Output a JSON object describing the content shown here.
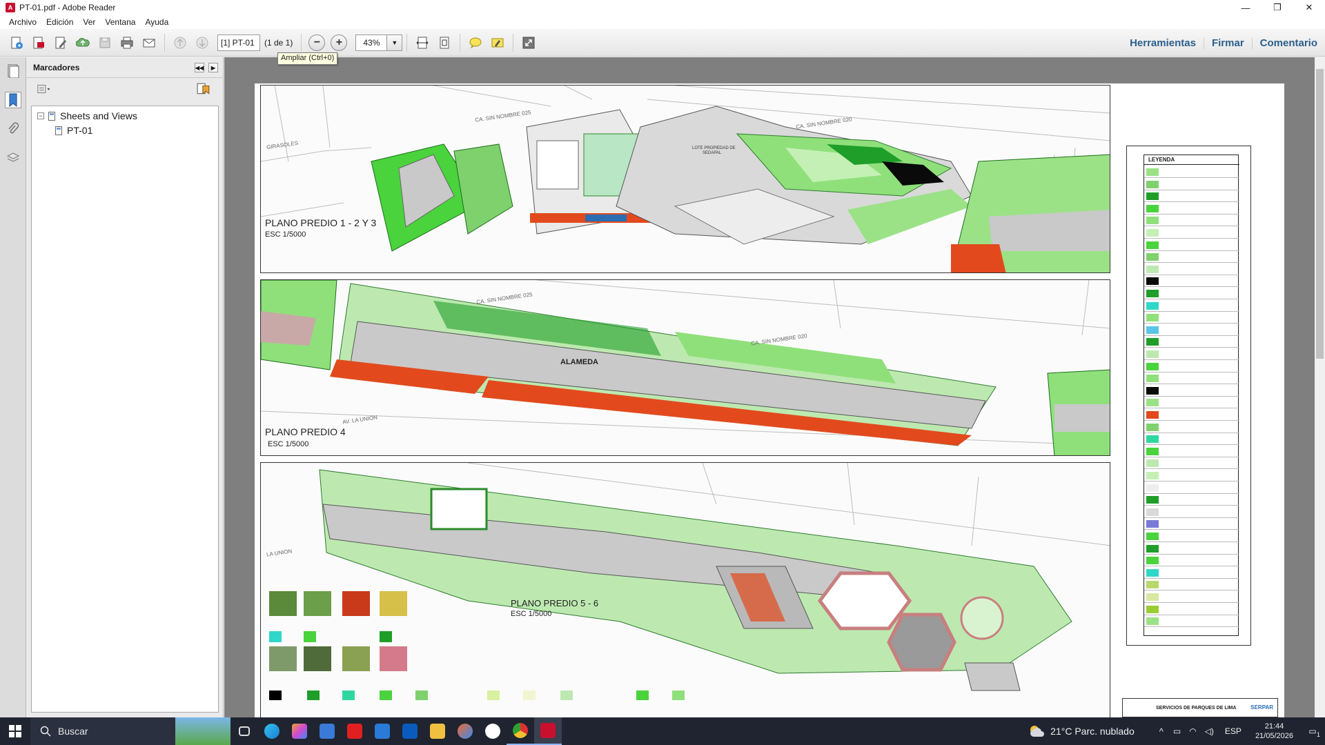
{
  "window": {
    "title": "PT-01.pdf - Adobe Reader",
    "minimize": "—",
    "maximize": "❐",
    "close": "✕"
  },
  "menu": [
    "Archivo",
    "Edición",
    "Ver",
    "Ventana",
    "Ayuda"
  ],
  "toolbar": {
    "page_field": "[1] PT-01",
    "page_count": "(1 de 1)",
    "zoom_value": "43%",
    "zoom_in_tooltip": "Ampliar (Ctrl+0)",
    "right_tools": [
      "Herramientas",
      "Firmar",
      "Comentario"
    ]
  },
  "bookmarks": {
    "title": "Marcadores",
    "tree": [
      {
        "label": "Sheets and Views",
        "expander": "−"
      },
      {
        "label": "PT-01"
      }
    ]
  },
  "document": {
    "plan1": {
      "title": "PLANO PREDIO 1 - 2 Y 3",
      "scale": "ESC 1/5000",
      "streets": [
        "GIRASOLES",
        "CA. SIN NOMBRE 025",
        "CA. SIN NOMBRE 020",
        "LOTE PROPIEDAD DE SEDAPAL"
      ]
    },
    "plan2": {
      "title": "PLANO PREDIO 4",
      "scale": "ESC 1/5000",
      "center_label": "ALAMEDA",
      "streets": [
        "CA. SIN NOMBRE 025",
        "CA. SIN NOMBRE 020",
        "AV. LA UNION"
      ]
    },
    "plan3": {
      "title": "PLANO PREDIO 5 - 6",
      "scale": "ESC 1/5000",
      "streets": [
        "LA UNION"
      ]
    },
    "legend": {
      "title": "LEYENDA"
    },
    "titleblock": {
      "text": "SERVICIOS DE PARQUES DE LIMA",
      "brand": "SERPAR"
    }
  },
  "taskbar": {
    "search_placeholder": "Buscar",
    "weather": "21°C  Parc. nublado",
    "lang": "ESP",
    "time": "21:44",
    "date": "21/05/2026",
    "notification_count": "1"
  },
  "colors": {
    "green_dark": "#1f9e2a",
    "green_light": "#8fe07a",
    "red_pattern": "#e24a1d",
    "paving": "#b9b9b9",
    "path_brown": "#c87f7f",
    "cyan": "#2fd7c9"
  }
}
